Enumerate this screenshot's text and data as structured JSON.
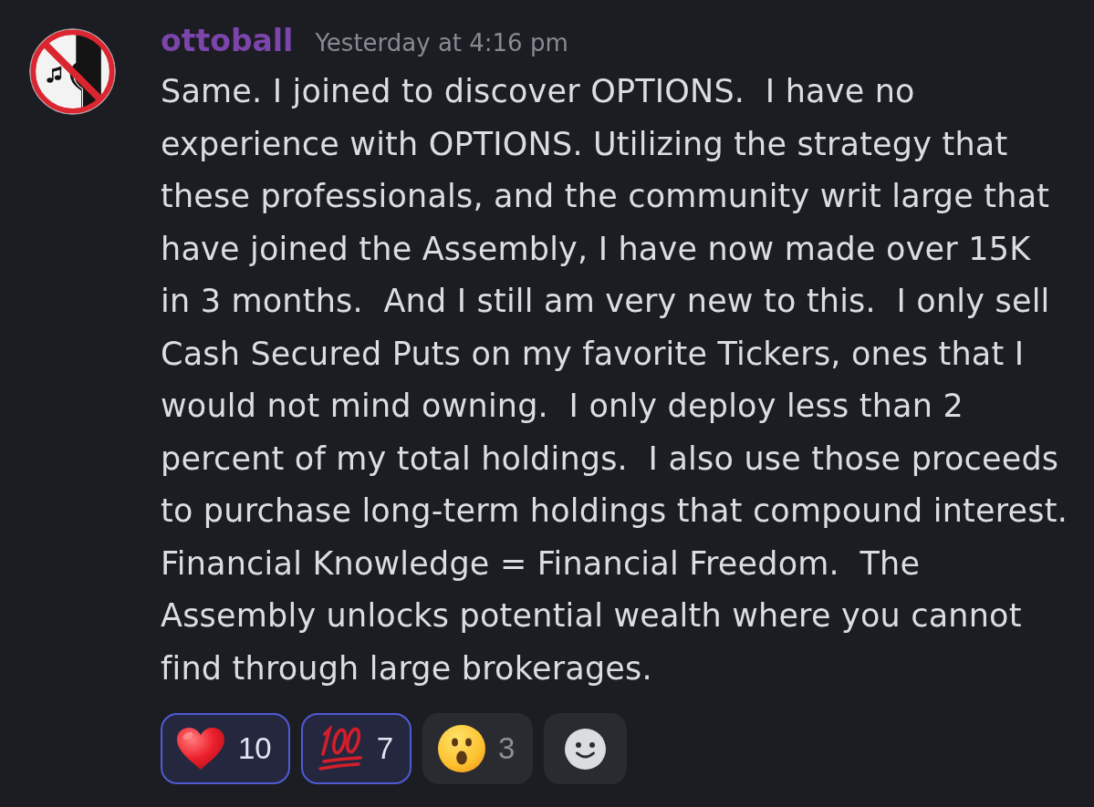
{
  "message": {
    "author": "ottoball",
    "timestamp": "Yesterday at 4:16 pm",
    "content": "Same. I joined to discover OPTIONS.  I have no experience with OPTIONS. Utilizing the strategy that these professionals, and the community writ large that have joined the Assembly, I have now made over 15K in 3 months.  And I still am very new to this.  I only sell Cash Secured Puts on my favorite Tickers, ones that I would not mind owning.  I only deploy less than 2 percent of my total holdings.  I also use those proceeds to purchase long-term holdings that compound interest.  Financial Knowledge = Financial Freedom.  The Assembly unlocks potential wealth where you cannot find through large brokerages.",
    "reactions": [
      {
        "kind": "heart",
        "count": "10",
        "selected": true
      },
      {
        "kind": "hundred",
        "count": "7",
        "selected": true
      },
      {
        "kind": "surprised",
        "count": "3",
        "selected": false
      }
    ]
  }
}
